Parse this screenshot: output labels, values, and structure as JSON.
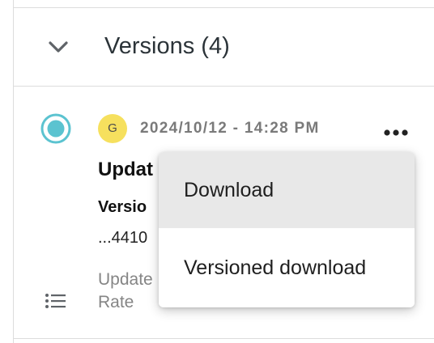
{
  "versions_section": {
    "title": "Versions (4)"
  },
  "version_entry": {
    "avatar_initial": "G",
    "avatar_color": "#f6e05e",
    "radio_color": "#5bc3d0",
    "timestamp": "2024/10/12 - 14:28 PM",
    "title": "Updat",
    "version_label": "Versio",
    "version_value": "...4410",
    "detail_line_1": "Update",
    "detail_line_2": "Rate"
  },
  "context_menu": {
    "items": [
      {
        "label": "Download",
        "highlighted": true
      },
      {
        "label": "Versioned download",
        "highlighted": false
      }
    ]
  },
  "icons": {
    "collapse": "chevron-down-icon",
    "more": "more-horizontal-icon",
    "details": "list-icon",
    "select": "radio-selected-icon"
  }
}
